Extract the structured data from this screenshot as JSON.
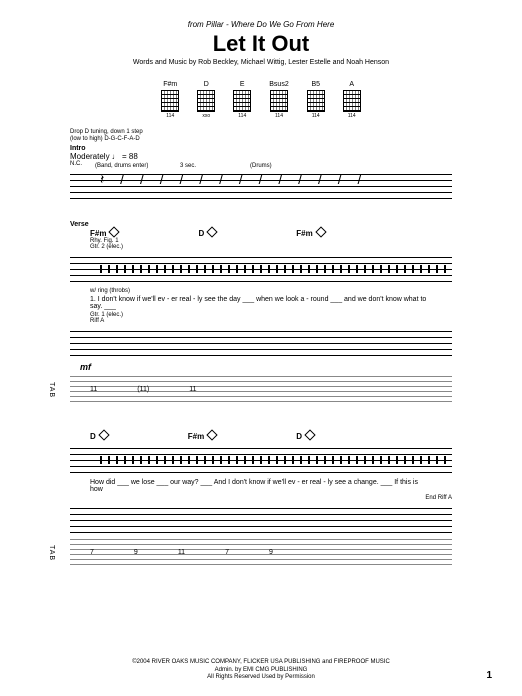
{
  "header": {
    "from": "from Pillar - Where Do We Go From Here",
    "title": "Let It Out",
    "credits": "Words and Music by Rob Beckley, Michael Wittig, Lester Estelle and Noah Henson"
  },
  "chords": [
    {
      "name": "F#m",
      "fret": "114"
    },
    {
      "name": "D",
      "fret": "xxo"
    },
    {
      "name": "E",
      "fret": "114"
    },
    {
      "name": "Bsus2",
      "fret": "114"
    },
    {
      "name": "B5",
      "fret": "114"
    },
    {
      "name": "A",
      "fret": "114"
    }
  ],
  "tuning": {
    "l1": "Drop D tuning, down 1 step",
    "l2": "(low to high) D-G-C-F-A-D"
  },
  "intro": {
    "label": "Intro",
    "tempo": "Moderately ♩ = 88",
    "nc": "N.C.",
    "anno1": "(Band, drums enter)",
    "anno2": "3 sec.",
    "anno3": "(Drums)"
  },
  "verse": {
    "label": "Verse",
    "chordRow1": [
      "F#m",
      "D",
      "F#m"
    ],
    "rhy": "Rhy. Fig. 1",
    "gtr2": "Gtr. 2 (elec.)",
    "wrang": "w/ ring (throbs)",
    "lyrics1": "1. I don't know if we'll ev - er real - ly see the day ___ when we look a - round ___ and we don't know what to say. ___",
    "gtr1": "Gtr. 1 (elec.)",
    "riff": "Riff A",
    "dynamic": "mf",
    "tabRow1": [
      "11",
      "(11)",
      "11"
    ],
    "chordRow2": [
      "D",
      "F#m",
      "D"
    ],
    "lyrics2": "How did ___ we lose ___ our way? ___ And I don't know if we'll ev - er real - ly see a change. ___ If this is how",
    "endRiff": "End Riff A",
    "tabRow2": [
      "7",
      "9",
      "11",
      "7",
      "9"
    ]
  },
  "footer": {
    "copyright": "©2004 RIVER OAKS MUSIC COMPANY, FLICKER USA PUBLISHING and FIREPROOF MUSIC",
    "admin": "Admin. by EMI CMG PUBLISHING",
    "rights": "All Rights Reserved  Used by Permission"
  },
  "pagenum": "1"
}
